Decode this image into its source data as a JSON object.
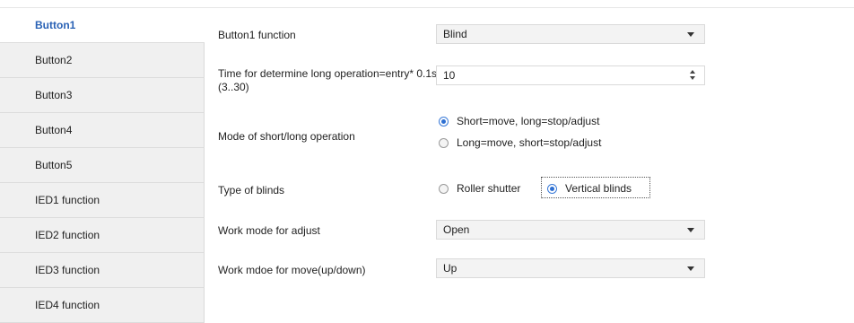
{
  "sidebar": {
    "items": [
      {
        "label": "Button1",
        "active": true
      },
      {
        "label": "Button2"
      },
      {
        "label": "Button3"
      },
      {
        "label": "Button4"
      },
      {
        "label": "Button5"
      },
      {
        "label": "IED1 function"
      },
      {
        "label": "IED2 function"
      },
      {
        "label": "IED3 function"
      },
      {
        "label": "IED4 function"
      }
    ]
  },
  "params": {
    "button_function": {
      "label": "Button1 function",
      "value": "Blind"
    },
    "long_time": {
      "label_line1": "Time for determine long operation=entry* 0.1s",
      "label_line2": "(3..30)",
      "value": "10"
    },
    "mode": {
      "label": "Mode of short/long operation",
      "options": [
        "Short=move, long=stop/adjust",
        "Long=move, short=stop/adjust"
      ],
      "selected": 0
    },
    "blind_type": {
      "label": "Type of blinds",
      "options": [
        "Roller shutter",
        "Vertical blinds"
      ],
      "selected": 1
    },
    "adjust_mode": {
      "label": "Work mode for adjust",
      "value": "Open"
    },
    "move_mode": {
      "label": "Work mdoe for move(up/down)",
      "value": "Up"
    }
  },
  "colors": {
    "active_tab": "#2a62b5",
    "radio_accent": "#2d6fd2"
  }
}
